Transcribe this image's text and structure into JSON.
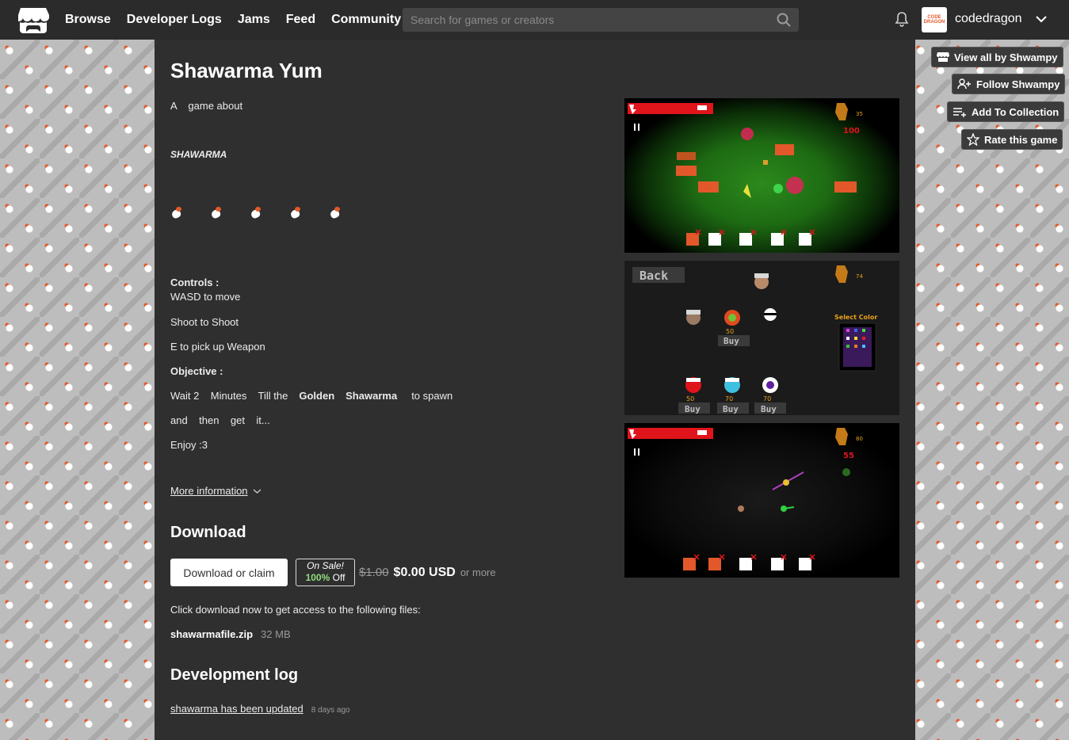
{
  "nav": {
    "links": [
      "Browse",
      "Developer Logs",
      "Jams",
      "Feed",
      "Community"
    ],
    "search_placeholder": "Search for games or creators",
    "username": "codedragon",
    "avatar_text": "CODE DRAGON"
  },
  "game": {
    "title": "Shawarma Yum",
    "description": {
      "intro": "A    game about",
      "emphasis": "SHAWARMA",
      "controls_heading": "Controls :",
      "controls": [
        "WASD to move",
        "Shoot to Shoot",
        "E to pick up Weapon"
      ],
      "objective_heading": "Objective :",
      "objective_line1_a": "Wait 2    Minutes    Till the",
      "objective_line1_b": "Golden",
      "objective_line1_c": "Shawarma",
      "objective_line1_d": "to spawn",
      "objective_line2": "and    then    get    it...",
      "closing": "Enjoy :3"
    },
    "more_info": "More information"
  },
  "download": {
    "heading": "Download",
    "button": "Download or claim",
    "sale_label": "On Sale!",
    "sale_pct": "100%",
    "sale_off": "Off",
    "old_price": "$1.00",
    "new_price": "$0.00 USD",
    "or_more": "or more",
    "note": "Click download now to get access to the following files:",
    "file_name": "shawarmafile.zip",
    "file_size": "32 MB"
  },
  "devlog": {
    "heading": "Development log",
    "entry": "shawarma has been updated",
    "entry_date": "8 days ago"
  },
  "screenshots": {
    "shot1": {
      "score": "100",
      "coins": "35"
    },
    "shot2": {
      "back": "Back",
      "coins": "74",
      "select_color": "Select Color",
      "price_top": "50",
      "buy": "Buy",
      "prices_bottom": [
        "50",
        "70",
        "70"
      ]
    },
    "shot3": {
      "score": "55",
      "coins": "80"
    }
  },
  "sidebar": {
    "view_all": "View all by Shwampy",
    "follow": "Follow Shwampy",
    "add_collection": "Add To Collection",
    "rate": "Rate this game"
  },
  "colors": {
    "nav_bg": "#2b2b2b",
    "main_bg": "#2f2f2f",
    "health_red": "#e0141b",
    "accent_orange": "#e25a2a"
  }
}
